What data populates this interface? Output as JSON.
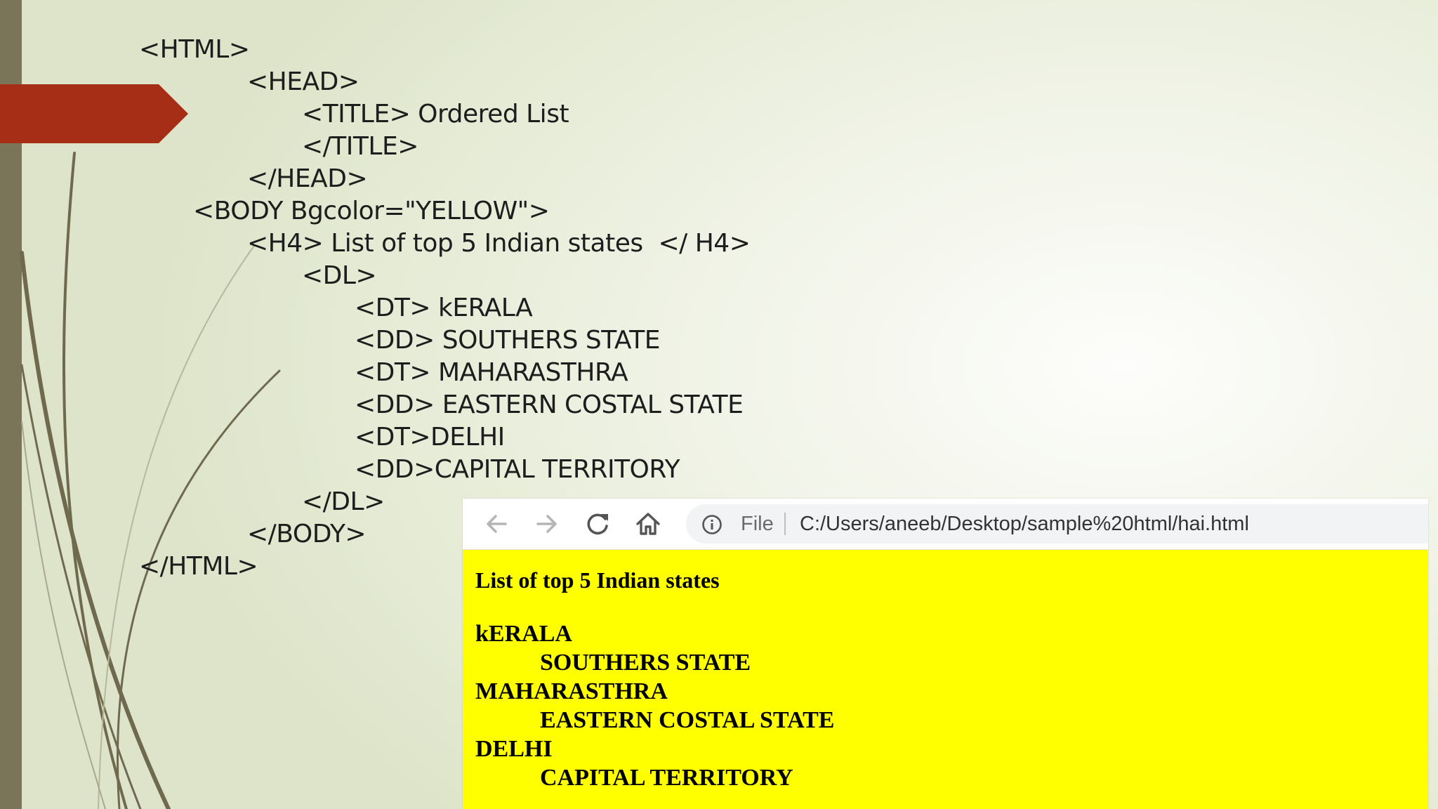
{
  "slide": {
    "code_lines": [
      "<HTML>",
      "<HEAD>",
      "<TITLE> Ordered List",
      "</TITLE>",
      "</HEAD>",
      "<BODY Bgcolor=\"YELLOW\">",
      "<H4> List of top 5 Indian states  </ H4>",
      "<DL>",
      "<DT> kERALA",
      "<DD> SOUTHERS STATE",
      "<DT> MAHARASTHRA",
      "<DD> EASTERN COSTAL STATE",
      "<DT>DELHI",
      "<DD>CAPITAL TERRITORY",
      "</DL>",
      "</BODY>",
      "</HTML>"
    ],
    "colors": {
      "accent_arrow": "#a62e17",
      "left_bar": "#7a7458",
      "curve": "#6f6a4f"
    }
  },
  "browser": {
    "toolbar": {
      "back_icon": "arrow-left-icon",
      "forward_icon": "arrow-right-icon",
      "reload_icon": "reload-icon",
      "home_icon": "home-icon",
      "info_icon": "info-icon",
      "scheme_label": "File",
      "url": "C:/Users/aneeb/Desktop/sample%20html/hai.html"
    },
    "page": {
      "background": "#ffff00",
      "heading": "List of top 5 Indian states",
      "definitions": [
        {
          "term": "kERALA",
          "description": "SOUTHERS STATE"
        },
        {
          "term": "MAHARASTHRA",
          "description": "EASTERN COSTAL STATE"
        },
        {
          "term": "DELHI",
          "description": "CAPITAL TERRITORY"
        }
      ]
    }
  }
}
